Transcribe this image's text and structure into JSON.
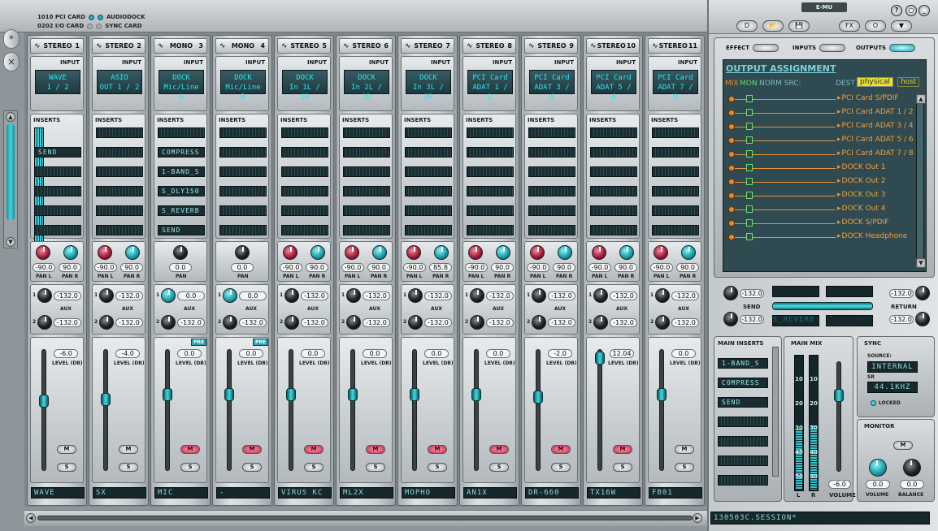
{
  "cards": {
    "row1a": "1010 PCI CARD",
    "row1b": "AUDIODOCK",
    "row2a": "0202 I/O CARD",
    "row2b": "SYNC CARD"
  },
  "side_buttons": [
    "*",
    "×"
  ],
  "strips": [
    {
      "type": "STEREO",
      "num": "1",
      "input": [
        "WAVE",
        "1 / 2"
      ],
      "inserts": [
        "",
        "SEND",
        "",
        "",
        "",
        ""
      ],
      "meter": true,
      "stereo": true,
      "pan_l": "-90.0",
      "pan_r": "90.0",
      "aux1": "-132.0",
      "aux2": "-132.0",
      "pre": false,
      "level": "-6.0",
      "muted": false,
      "name": "WAVE",
      "fader": 0.58
    },
    {
      "type": "STEREO",
      "num": "2",
      "input": [
        "ASIO",
        "OUT 1 / 2"
      ],
      "inserts": [
        "",
        "",
        "",
        "",
        "",
        ""
      ],
      "meter": false,
      "stereo": true,
      "pan_l": "-90.0",
      "pan_r": "90.0",
      "aux1": "-132.0",
      "aux2": "-132.0",
      "pre": false,
      "level": "-4.0",
      "muted": false,
      "name": "SX",
      "fader": 0.6
    },
    {
      "type": "MONO",
      "num": "3",
      "input": [
        "DOCK",
        "Mic/Line A"
      ],
      "inserts": [
        "",
        "COMPRESS",
        "1-BAND_S",
        "S_DLY150",
        "S_REVERB",
        "SEND"
      ],
      "meter": false,
      "stereo": false,
      "pan": "0.0",
      "aux1": "0.0",
      "aux2": "-132.0",
      "pre": true,
      "level": "0.0",
      "muted": true,
      "name": "MIC",
      "fader": 0.64
    },
    {
      "type": "MONO",
      "num": "4",
      "input": [
        "DOCK",
        "Mic/Line B"
      ],
      "inserts": [
        "",
        "",
        "",
        "",
        "",
        ""
      ],
      "meter": false,
      "stereo": false,
      "pan": "0.0",
      "aux1": "0.0",
      "aux2": "-132.0",
      "pre": true,
      "level": "0.0",
      "muted": true,
      "name": "-",
      "fader": 0.64
    },
    {
      "type": "STEREO",
      "num": "5",
      "input": [
        "DOCK",
        "In 1L / 1R"
      ],
      "inserts": [
        "",
        "",
        "",
        "",
        "",
        ""
      ],
      "meter": false,
      "stereo": true,
      "pan_l": "-90.0",
      "pan_r": "90.0",
      "aux1": "-132.0",
      "aux2": "-132.0",
      "pre": false,
      "level": "0.0",
      "muted": true,
      "name": "VIRUS KC",
      "fader": 0.64
    },
    {
      "type": "STEREO",
      "num": "6",
      "input": [
        "DOCK",
        "In 2L / 2R"
      ],
      "inserts": [
        "",
        "",
        "",
        "",
        "",
        ""
      ],
      "meter": false,
      "stereo": true,
      "pan_l": "-90.0",
      "pan_r": "90.0",
      "aux1": "-132.0",
      "aux2": "-132.0",
      "pre": false,
      "level": "0.0",
      "muted": true,
      "name": "ML2X",
      "fader": 0.64
    },
    {
      "type": "STEREO",
      "num": "7",
      "input": [
        "DOCK",
        "In 3L / 3R"
      ],
      "inserts": [
        "",
        "",
        "",
        "",
        "",
        ""
      ],
      "meter": false,
      "stereo": true,
      "pan_l": "-90.0",
      "pan_r": "85.8",
      "aux1": "-132.0",
      "aux2": "-132.0",
      "pre": false,
      "level": "0.0",
      "muted": true,
      "name": "MOPHO",
      "fader": 0.64
    },
    {
      "type": "STEREO",
      "num": "8",
      "input": [
        "PCI Card",
        "ADAT 1 / 2"
      ],
      "inserts": [
        "",
        "",
        "",
        "",
        "",
        ""
      ],
      "meter": false,
      "stereo": true,
      "pan_l": "-90.0",
      "pan_r": "90.0",
      "aux1": "-132.0",
      "aux2": "-132.0",
      "pre": false,
      "level": "0.0",
      "muted": true,
      "name": "AN1X",
      "fader": 0.64
    },
    {
      "type": "STEREO",
      "num": "9",
      "input": [
        "PCI Card",
        "ADAT 3 / 4"
      ],
      "inserts": [
        "",
        "",
        "",
        "",
        "",
        ""
      ],
      "meter": false,
      "stereo": true,
      "pan_l": "-90.0",
      "pan_r": "90.0",
      "aux1": "-132.0",
      "aux2": "-132.0",
      "pre": false,
      "level": "-2.0",
      "muted": true,
      "name": "DR-660",
      "fader": 0.62
    },
    {
      "type": "STEREO",
      "num": "10",
      "input": [
        "PCI Card",
        "ADAT 5 / 6"
      ],
      "inserts": [
        "",
        "",
        "",
        "",
        "",
        ""
      ],
      "meter": false,
      "stereo": true,
      "pan_l": "-90.0",
      "pan_r": "90.0",
      "aux1": "-132.0",
      "aux2": "-132.0",
      "pre": false,
      "level": "12.04",
      "muted": true,
      "name": "TX16W",
      "fader": 0.98
    },
    {
      "type": "STEREO",
      "num": "11",
      "input": [
        "PCI Card",
        "ADAT 7 / 8"
      ],
      "inserts": [
        "",
        "",
        "",
        "",
        "",
        ""
      ],
      "meter": false,
      "stereo": true,
      "pan_l": "-90.0",
      "pan_r": "90.0",
      "aux1": "-132.0",
      "aux2": "-132.0",
      "pre": false,
      "level": "0.0",
      "muted": false,
      "name": "FB01",
      "fader": 0.64
    }
  ],
  "labels": {
    "input": "INPUT",
    "inserts": "INSERTS",
    "pan_l": "PAN L",
    "pan_r": "PAN R",
    "pan": "PAN",
    "aux": "AUX",
    "level": "LEVEL (DB)",
    "pre": "PRE",
    "m": "M",
    "s": "S"
  },
  "right": {
    "brand": "E-MU",
    "toolbar": [
      "D",
      "📂",
      "💾",
      "FX",
      "O",
      "▼"
    ],
    "win": [
      "?",
      "○",
      "_",
      "×"
    ],
    "tabs": {
      "effect": "EFFECT",
      "inputs": "INPUTS",
      "outputs": "OUTPUTS"
    },
    "output": {
      "title": "OUTPUT ASSIGNMENT",
      "mix": "MIX",
      "mon": "MON",
      "norm": "NORM SRC:",
      "dest": "DEST",
      "physical": "physical",
      "host": "host",
      "destinations": [
        "PCI Card S/PDIF",
        "PCI Card ADAT 1 / 2",
        "PCI Card ADAT 3 / 4",
        "PCI Card ADAT 5 / 6",
        "PCI Card ADAT 7 / 8",
        "DOCK Out 1",
        "DOCK Out 2",
        "DOCK Out 3",
        "DOCK Out 4",
        "DOCK S/PDIF",
        "DOCK Headphone"
      ]
    },
    "send": {
      "label": "SEND",
      "aux1": "-132.0",
      "aux2": "-132.0",
      "lcd": "S_REVERB"
    },
    "return": {
      "label": "RETURN",
      "aux1": "-132.0",
      "aux2": "-132.0"
    },
    "main_inserts": {
      "title": "MAIN INSERTS",
      "items": [
        "1-BAND_S",
        "COMPRESS",
        "SEND",
        "",
        "",
        "",
        ""
      ]
    },
    "main_mix": {
      "title": "MAIN MIX",
      "ticks": [
        "10",
        "20",
        "30",
        "40",
        "50"
      ],
      "l": "L",
      "r": "R",
      "volume": "-6.0",
      "volume_label": "VOLUME",
      "level_l": 0.46,
      "level_r": 0.48
    },
    "sync": {
      "title": "SYNC",
      "source_label": "SOURCE:",
      "source": "INTERNAL",
      "sr_label": "SR",
      "sr": "44.1KHZ",
      "locked": "LOCKED"
    },
    "monitor": {
      "title": "MONITOR",
      "volume": "0.0",
      "balance": "0.0",
      "volume_label": "VOLUME",
      "balance_label": "BALANCE",
      "m": "M"
    },
    "session": "130503C.SESSION*"
  }
}
